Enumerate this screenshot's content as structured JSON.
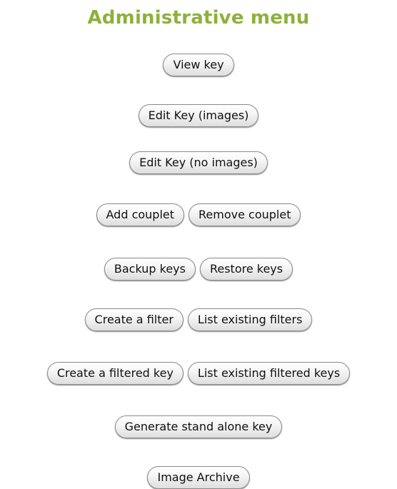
{
  "menu": {
    "title": "Administrative menu",
    "view_key": "View key",
    "edit_key_images": "Edit Key (images)",
    "edit_key_no_images": "Edit Key (no images)",
    "add_couplet": "Add couplet",
    "remove_couplet": "Remove couplet",
    "backup_keys": "Backup keys",
    "restore_keys": "Restore keys",
    "create_filter": "Create a filter",
    "list_filters": "List existing filters",
    "create_filtered_key": "Create a filtered key",
    "list_filtered_keys": "List existing filtered keys",
    "generate_standalone": "Generate stand alone key",
    "image_archive": "Image Archive"
  },
  "colors": {
    "title": "#8eb13a"
  }
}
